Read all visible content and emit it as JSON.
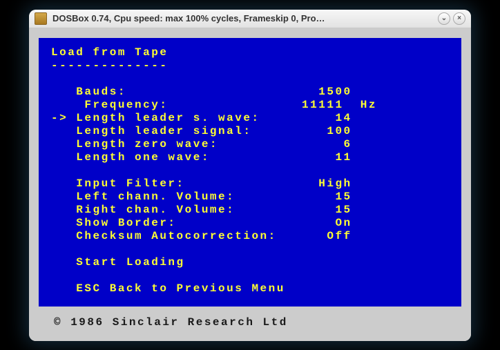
{
  "window": {
    "title": "DOSBox 0.74, Cpu speed: max 100% cycles, Frameskip  0, Pro…",
    "minimize": "⌄",
    "close": "×"
  },
  "screen": {
    "title": "Load from Tape",
    "underline": "--------------",
    "rows": [
      {
        "label": "Bauds:",
        "value": "1500",
        "selected": false
      },
      {
        "label": "Frequency:",
        "value": "11111  Hz",
        "selected": false,
        "indent": true
      },
      {
        "label": "Length leader s. wave:",
        "value": "14",
        "selected": true
      },
      {
        "label": "Length leader signal:",
        "value": "100",
        "selected": false
      },
      {
        "label": "Length zero wave:",
        "value": "6",
        "selected": false
      },
      {
        "label": "Length one wave:",
        "value": "11",
        "selected": false
      },
      {
        "label": "Input Filter:",
        "value": "High",
        "selected": false,
        "gap": true
      },
      {
        "label": "Left chann. Volume:",
        "value": "15",
        "selected": false
      },
      {
        "label": "Right chan. Volume:",
        "value": "15",
        "selected": false
      },
      {
        "label": "Show Border:",
        "value": "On",
        "selected": false
      },
      {
        "label": "Checksum Autocorrection:",
        "value": "Off",
        "selected": false
      }
    ],
    "start": "Start Loading",
    "back": "ESC Back to Previous Menu"
  },
  "footer": "© 1986 Sinclair Research Ltd"
}
